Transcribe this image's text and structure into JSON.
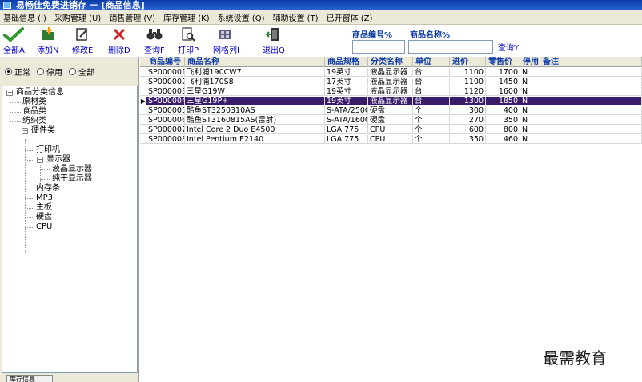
{
  "window": {
    "title": "易畅佳免费进销存 － [商品信息]"
  },
  "menu": [
    "基础信息 (I)",
    "采购管理 (U)",
    "销售管理 (V)",
    "库存管理 (K)",
    "系统设置 (Q)",
    "辅助设置 (T)",
    "已开窗体 (Z)"
  ],
  "toolbar": {
    "all": "全部A",
    "add": "添加N",
    "edit": "修改E",
    "delete": "删除D",
    "find": "查询F",
    "print": "打印P",
    "grid_cols": "网格列I",
    "exit": "退出Q"
  },
  "search": {
    "code_label": "商品编号%",
    "name_label": "商品名称%",
    "code_value": "",
    "name_value": "",
    "query": "查询Y"
  },
  "filter": {
    "options": [
      "正常",
      "停用",
      "全部"
    ],
    "selected": 0
  },
  "tree": {
    "root": "商品分类信息",
    "n1": "原材类",
    "n2": "食品类",
    "n3": "纺织类",
    "n4": "硬件类",
    "n4a": "打印机",
    "n4b": "显示器",
    "n4b1": "液晶显示器",
    "n4b2": "纯平显示器",
    "n4c": "内存条",
    "n4d": "MP3",
    "n4e": "主板",
    "n4f": "硬盘",
    "n4g": "CPU"
  },
  "bottom_tab": "库存信息",
  "grid": {
    "columns": [
      "商品编号",
      "商品名称",
      "商品规格",
      "分类名称",
      "单位",
      "进价",
      "零售价",
      "停用",
      "备注"
    ],
    "rows": [
      {
        "code": "SP000001",
        "name": "飞利浦190CW7",
        "spec": "19英寸",
        "category": "液晶显示器",
        "unit": "台",
        "cost": "1100",
        "retail": "1700",
        "disabled": "N",
        "note": ""
      },
      {
        "code": "SP000002",
        "name": "飞利浦170S8",
        "spec": "17英寸",
        "category": "液晶显示器",
        "unit": "台",
        "cost": "1100",
        "retail": "1450",
        "disabled": "N",
        "note": ""
      },
      {
        "code": "SP000003",
        "name": "三星G19W",
        "spec": "19英寸",
        "category": "液晶显示器",
        "unit": "台",
        "cost": "1120",
        "retail": "1600",
        "disabled": "N",
        "note": ""
      },
      {
        "code": "SP000004",
        "name": "三星G19P+",
        "spec": "19英寸",
        "category": "液晶显示器",
        "unit": "台",
        "cost": "1300",
        "retail": "1850",
        "disabled": "N",
        "note": ""
      },
      {
        "code": "SP000005",
        "name": "酷鱼ST3250310AS",
        "spec": "S-ATA/250G",
        "category": "硬盘",
        "unit": "个",
        "cost": "300",
        "retail": "400",
        "disabled": "N",
        "note": ""
      },
      {
        "code": "SP000006",
        "name": "酷鱼ST3160815AS(雷射)",
        "spec": "S-ATA/160G",
        "category": "硬盘",
        "unit": "个",
        "cost": "270",
        "retail": "350",
        "disabled": "N",
        "note": ""
      },
      {
        "code": "SP000007",
        "name": "Intel Core 2 Duo E4500",
        "spec": "LGA 775",
        "category": "CPU",
        "unit": "个",
        "cost": "600",
        "retail": "800",
        "disabled": "N",
        "note": ""
      },
      {
        "code": "SP000008",
        "name": "Intel Pentium E2140",
        "spec": "LGA 775",
        "category": "CPU",
        "unit": "个",
        "cost": "350",
        "retail": "460",
        "disabled": "N",
        "note": ""
      }
    ],
    "selected_row": 3,
    "selection_color": "#3a1c6b"
  },
  "watermark": "最需教育"
}
